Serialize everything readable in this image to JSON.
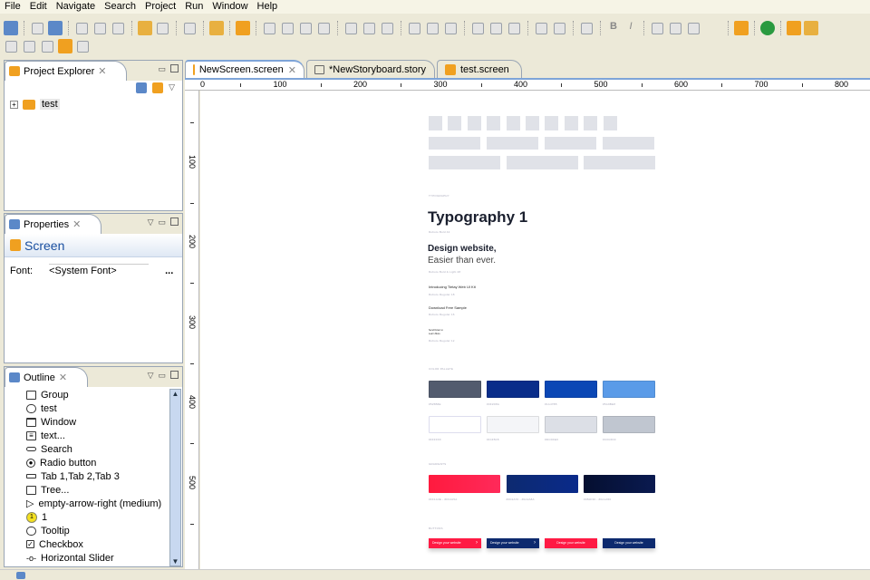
{
  "menu": [
    "File",
    "Edit",
    "Navigate",
    "Search",
    "Project",
    "Run",
    "Window",
    "Help"
  ],
  "panels": {
    "project_explorer": {
      "title": "Project Explorer",
      "tree": [
        {
          "label": "test"
        }
      ]
    },
    "properties": {
      "title": "Properties",
      "heading": "Screen",
      "font_label": "Font:",
      "font_value": "<System Font>",
      "more": "..."
    },
    "outline": {
      "title": "Outline",
      "items": [
        "Group",
        "test",
        "Window",
        "text...",
        "Search",
        "Radio button",
        "Tab 1,Tab 2,Tab 3",
        "Tree...",
        "empty-arrow-right (medium)",
        "1",
        "Tooltip",
        "Checkbox",
        "Horizontal Slider"
      ]
    }
  },
  "editor": {
    "tabs": [
      {
        "label": "NewScreen.screen",
        "active": true
      },
      {
        "label": "*NewStoryboard.story",
        "active": false
      },
      {
        "label": "test.screen",
        "active": false
      }
    ],
    "hruler": [
      "0",
      "100",
      "200",
      "300",
      "400",
      "500",
      "600",
      "700",
      "800"
    ],
    "vruler": [
      "100",
      "200",
      "300",
      "400",
      "500"
    ]
  },
  "design": {
    "typography_label": "TYPOGRAPHY",
    "title": "Typography 1",
    "title_caption": "Roboto Bold 42",
    "headline_bold": "Design website,",
    "headline_light": "Easier than ever.",
    "headline_caption": "Roboto Bold & Light 28",
    "line1": "Introducing Tietay Web UI Kit",
    "line1_caption": "Roboto Regular 18",
    "line2": "Download Free Sample",
    "line2_caption": "Roboto Regular 16",
    "line3a": "Send Down to",
    "line3b": "Learn More",
    "line3_caption": "Roboto Regular 12",
    "palette_label": "COLOR PALLETE",
    "palette": [
      {
        "color": "#525b6e",
        "label": "#525B6E"
      },
      {
        "color": "#0a2d8a",
        "label": "#0F2D8A"
      },
      {
        "color": "#0b47b5",
        "label": "#1A47B5"
      },
      {
        "color": "#5a9be8",
        "label": "#5A9BE8"
      },
      {
        "color": "#ffffff",
        "label": "#FFFFFF"
      },
      {
        "color": "#f4f5f8",
        "label": "#F4F5F8"
      },
      {
        "color": "#dcdfe6",
        "label": "#DCDFE6"
      },
      {
        "color": "#c0c6d0",
        "label": "#C0C6D0"
      }
    ],
    "gradients_label": "GRADIENTS",
    "gradients": [
      {
        "from": "#ff1a3e",
        "to": "#ff2a5a",
        "label": "#FF1A3E - #FF2A5A"
      },
      {
        "from": "#0d2a70",
        "to": "#0a2a8a",
        "label": "#0D2A70 - #0A2A8A"
      },
      {
        "from": "#050f30",
        "to": "#0a1a50",
        "label": "#050F30 - #0A1A50"
      }
    ],
    "buttons_label": "BUTTONS",
    "buttons": [
      {
        "label": "Design your website",
        "arrow": "›",
        "color": "#ff1a44"
      },
      {
        "label": "Design your website",
        "arrow": "›",
        "color": "#0d2a6e"
      },
      {
        "label": "Design your website",
        "arrow": "",
        "color": "#ff1a44"
      },
      {
        "label": "Design your website",
        "arrow": "",
        "color": "#0d2a6e"
      }
    ]
  }
}
